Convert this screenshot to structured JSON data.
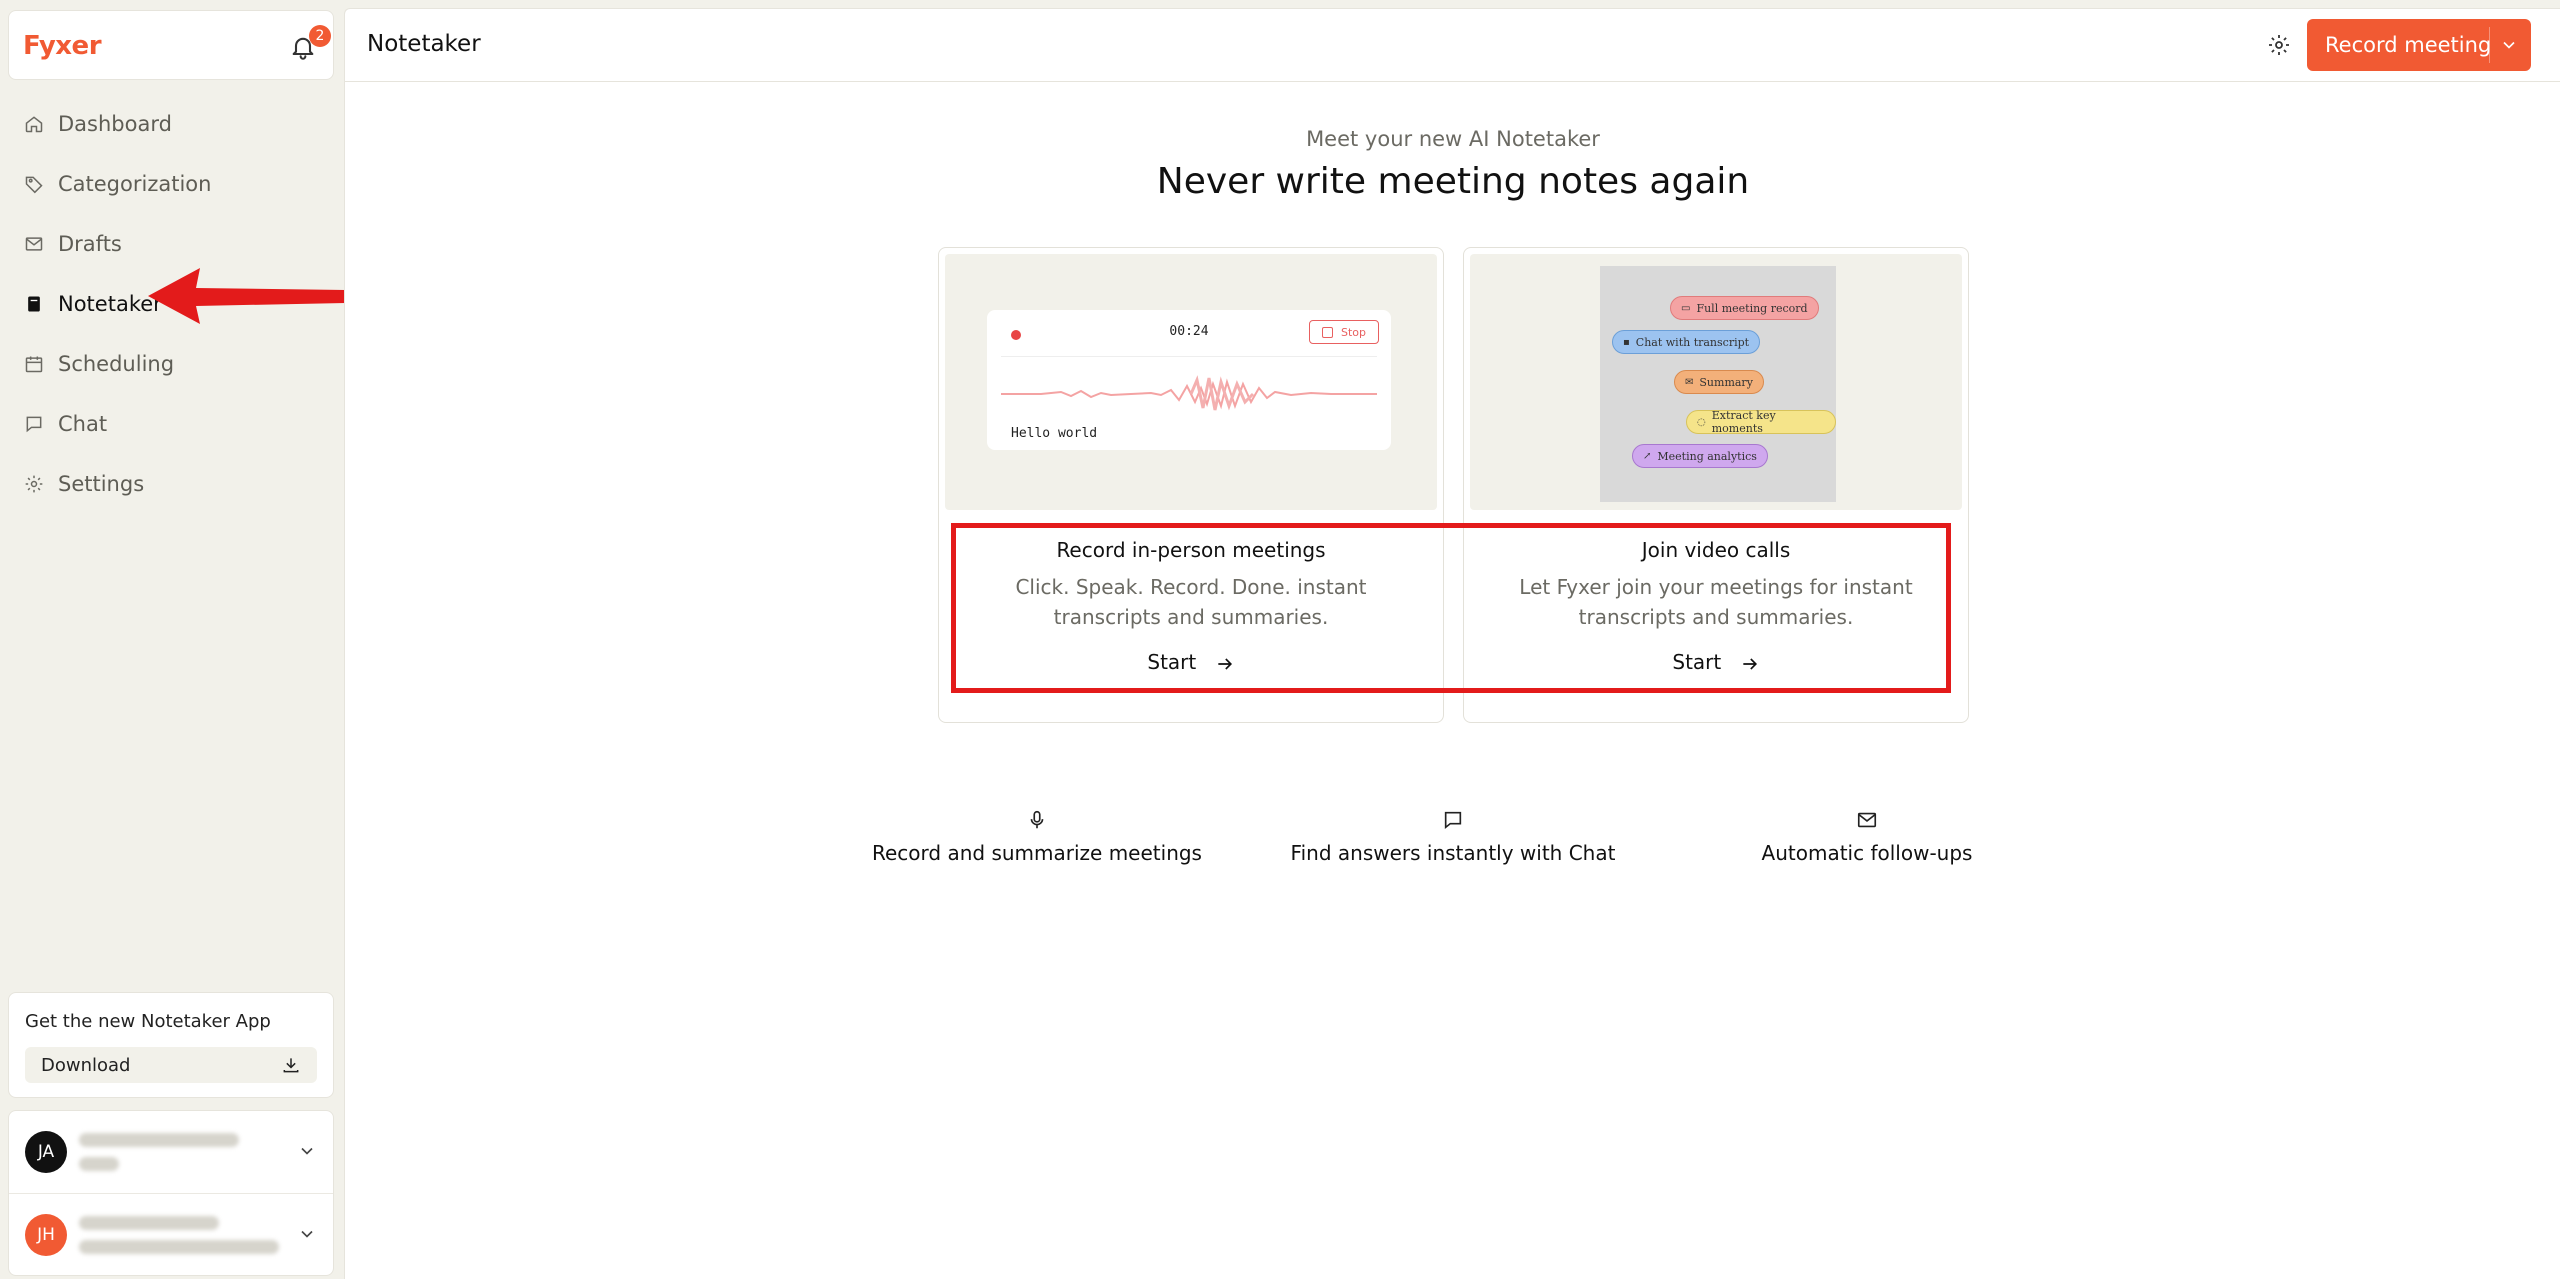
{
  "sidebar": {
    "logo": "Fyxer",
    "notifications": "2",
    "items": [
      {
        "label": "Dashboard",
        "icon": "home-icon"
      },
      {
        "label": "Categorization",
        "icon": "tag-icon"
      },
      {
        "label": "Drafts",
        "icon": "mail-icon"
      },
      {
        "label": "Notetaker",
        "icon": "notebook-icon",
        "active": true
      },
      {
        "label": "Scheduling",
        "icon": "calendar-icon"
      },
      {
        "label": "Chat",
        "icon": "chat-icon"
      },
      {
        "label": "Settings",
        "icon": "gear-icon"
      }
    ],
    "promo": {
      "title": "Get the new Notetaker App",
      "button": "Download"
    },
    "accounts": [
      {
        "initials": "JA",
        "color": "#111111"
      },
      {
        "initials": "JH",
        "color": "#f15a33"
      }
    ]
  },
  "header": {
    "title": "Notetaker",
    "record_button": "Record meeting"
  },
  "hero": {
    "subtitle": "Meet your new AI Notetaker",
    "headline": "Never write meeting notes again"
  },
  "cards": [
    {
      "title": "Record in-person meetings",
      "description": "Click. Speak. Record. Done. instant transcripts and summaries.",
      "cta": "Start",
      "preview": {
        "time": "00:24",
        "stop": "Stop",
        "transcript": "Hello world"
      }
    },
    {
      "title": "Join video calls",
      "description": "Let Fyxer join your meetings for instant transcripts and summaries.",
      "cta": "Start",
      "preview": {
        "pills": [
          {
            "label": "Full meeting record",
            "color": "#f4a3a3",
            "border": "#e07b7b"
          },
          {
            "label": "Chat with transcript",
            "color": "#9cc3f0",
            "border": "#6b9fd8"
          },
          {
            "label": "Summary",
            "color": "#f3b07a",
            "border": "#d98a4e"
          },
          {
            "label": "Extract key moments",
            "color": "#f5e48a",
            "border": "#d8c35a"
          },
          {
            "label": "Meeting analytics",
            "color": "#cfa8ee",
            "border": "#a878cf"
          }
        ]
      }
    }
  ],
  "features": [
    {
      "label": "Record and summarize meetings",
      "icon": "microphone-icon"
    },
    {
      "label": "Find answers instantly with Chat",
      "icon": "chat-bubble-icon"
    },
    {
      "label": "Automatic follow-ups",
      "icon": "envelope-icon"
    }
  ],
  "colors": {
    "accent": "#f15a33",
    "annotation": "#e31b1b"
  }
}
